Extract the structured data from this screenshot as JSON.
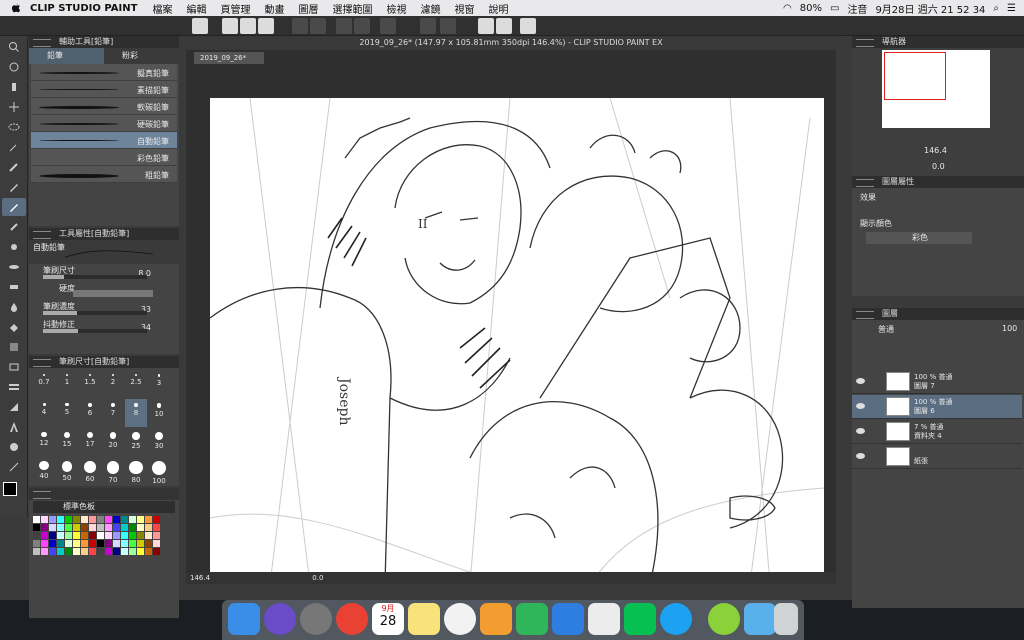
{
  "menubar": {
    "app": "CLIP STUDIO PAINT",
    "items": [
      "檔案",
      "編輯",
      "頁管理",
      "動畫",
      "圖層",
      "選擇範圍",
      "檢視",
      "濾鏡",
      "視窗",
      "說明"
    ],
    "battery": "80%",
    "note": "注音",
    "datetime": "9月28日 週六  21 52 34"
  },
  "document": {
    "title": "2019_09_26* (147.97 x 105.81mm 350dpi 146.4%) - CLIP STUDIO PAINT EX",
    "tab": "2019_09_26*"
  },
  "subtool": {
    "title": "輔助工具[鉛筆]",
    "tabs": [
      "鉛筆",
      "粉彩"
    ],
    "brushes": [
      "擬真鉛筆",
      "素描鉛筆",
      "軟碳鉛筆",
      "硬碳鉛筆",
      "自動鉛筆",
      "彩色鉛筆",
      "粗鉛筆"
    ],
    "selected": "自動鉛筆"
  },
  "toolprop": {
    "title": "工具屬性[自動鉛筆]",
    "preset": "自動鉛筆",
    "rows": [
      {
        "label": "筆刷尺寸",
        "value": "8.0",
        "fill": 0.2
      },
      {
        "label": "硬度",
        "value": "",
        "fill": 0.5
      },
      {
        "label": "筆刷濃度",
        "value": "33",
        "fill": 0.33
      },
      {
        "label": "抖動修正",
        "value": "34",
        "fill": 0.34
      }
    ]
  },
  "brushsize": {
    "title": "筆刷尺寸[自動鉛筆]",
    "sizes": [
      "0.7",
      "1",
      "1.5",
      "2",
      "2.5",
      "3",
      "4",
      "5",
      "6",
      "7",
      "8",
      "10",
      "12",
      "15",
      "17",
      "20",
      "25",
      "30",
      "40",
      "50",
      "60",
      "70",
      "80",
      "100"
    ],
    "selected": "8"
  },
  "colorset": {
    "title": "標準色板"
  },
  "status": {
    "zoom": "146.4",
    "angle": "0.0"
  },
  "navigator": {
    "title": "導航器",
    "zoom": "146.4",
    "angle": "0.0"
  },
  "colorprop": {
    "title": "圖層屬性",
    "effect_label": "效果",
    "display_label": "顯示顏色",
    "display_value": "彩色"
  },
  "layers": {
    "title": "圖層",
    "blend": "普通",
    "opacity": "100",
    "items": [
      {
        "percent": "100 %  普通",
        "name": "圖層 7",
        "selected": false
      },
      {
        "percent": "100 %  普通",
        "name": "圖層 6",
        "selected": true
      },
      {
        "percent": "7 %  普通",
        "name": "資料夾 4",
        "selected": false
      },
      {
        "percent": "",
        "name": "紙張",
        "selected": false
      }
    ]
  },
  "dock": {
    "calendar_day": "28",
    "calendar_month": "9月"
  },
  "canvas_text": {
    "name": "Joseph",
    "roman": "II"
  }
}
